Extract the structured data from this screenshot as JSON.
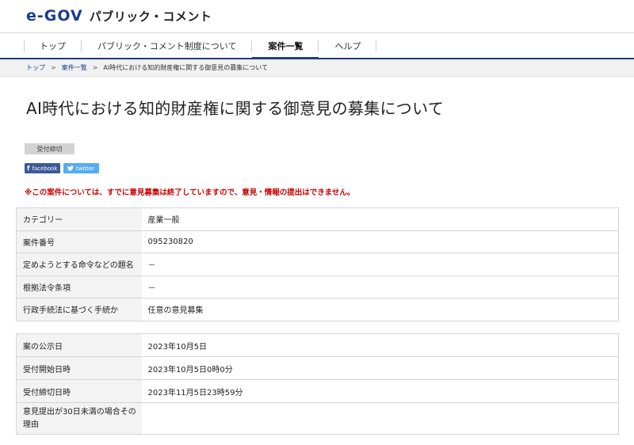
{
  "header": {
    "logo_text": "e-GOV",
    "site_title": "パブリック・コメント"
  },
  "nav": {
    "items": [
      {
        "label": "トップ"
      },
      {
        "label": "パブリック・コメント制度について"
      },
      {
        "label": "案件一覧"
      },
      {
        "label": "ヘルプ"
      }
    ],
    "active_index": 2
  },
  "breadcrumb": {
    "items": [
      "トップ",
      "案件一覧",
      "AI時代における知的財産権に関する御意見の募集について"
    ],
    "separator": ">"
  },
  "page": {
    "title": "AI時代における知的財産権に関する御意見の募集について",
    "status_badge": "受付締切",
    "share": {
      "facebook_label": "facebook",
      "twitter_label": "twitter"
    },
    "notice": "※この案件については、すでに意見募集は終了していますので、意見・情報の提出はできません。"
  },
  "details_table": [
    {
      "label": "カテゴリー",
      "value": "産業一般"
    },
    {
      "label": "案件番号",
      "value": "095230820"
    },
    {
      "label": "定めようとする命令などの題名",
      "value": "－"
    },
    {
      "label": "根拠法令条項",
      "value": "－"
    },
    {
      "label": "行政手続法に基づく手続か",
      "value": "任意の意見募集"
    }
  ],
  "dates_table": [
    {
      "label": "案の公示日",
      "value": "2023年10月5日"
    },
    {
      "label": "受付開始日時",
      "value": "2023年10月5日0時0分"
    },
    {
      "label": "受付締切日時",
      "value": "2023年11月5日23時59分"
    },
    {
      "label": "意見提出が30日未満の場合その理由",
      "value": ""
    }
  ],
  "colors": {
    "brand": "#1c3c8c",
    "notice": "#cc0000",
    "facebook": "#3b5998",
    "twitter": "#55acee",
    "label_bg": "#f3f3f3"
  }
}
